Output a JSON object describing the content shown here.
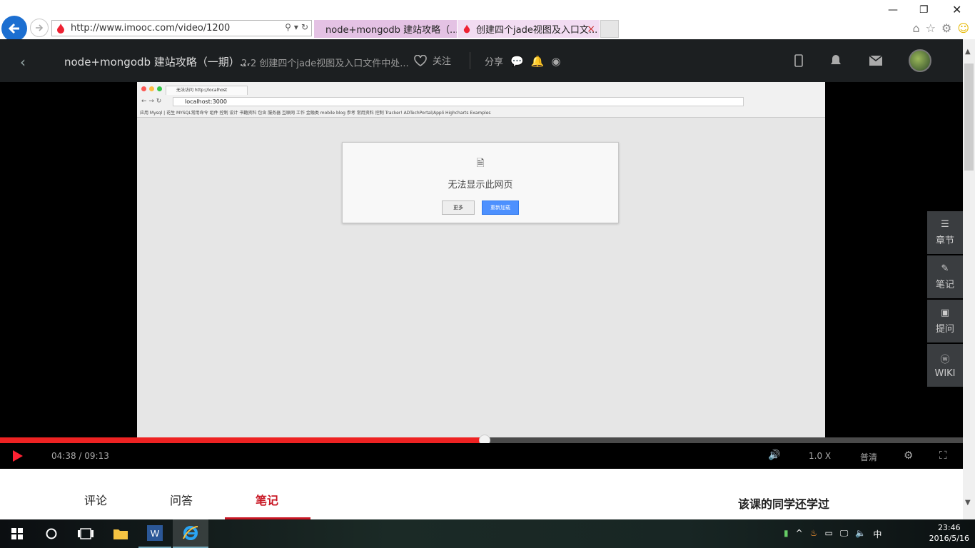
{
  "browser": {
    "url": "http://www.imooc.com/video/1200",
    "tabs": [
      {
        "label": "node+mongodb 建站攻略（..."
      },
      {
        "label": "创建四个jade视图及入口文...",
        "close": "×"
      }
    ]
  },
  "header": {
    "back": "‹",
    "course_title": "node+mongodb 建站攻略（一期）...",
    "lesson_title": "2-2 创建四个jade视图及入口文件中处...",
    "follow_label": "关注",
    "share_label": "分享"
  },
  "video_frame": {
    "chrome_tab": "无法访问 http://localhost",
    "address": "localhost:3000",
    "bookmarks": "应用   Mysql | 花生   MYSQL常用命令   组件   控制   设计   书籍资料   包含   服务器   互联网   工作   金融类   mobile   blog   参考   常用资料   控制   Tracker!   ADTechPortal/Appli   Highcharts Examples",
    "error_title": "无法显示此网页",
    "more_button": "更多",
    "reload_button": "重新加载"
  },
  "side_tabs": [
    {
      "label": "章节",
      "icon": "list-icon"
    },
    {
      "label": "笔记",
      "icon": "pencil-icon"
    },
    {
      "label": "提问",
      "icon": "question-icon"
    },
    {
      "label": "WIKI",
      "icon": "wiki-icon"
    }
  ],
  "player": {
    "time": "04:38 / 09:13",
    "progress": 0.503,
    "speed": "1.0 X",
    "quality": "普清"
  },
  "below_tabs": {
    "comments": "评论",
    "qa": "问答",
    "notes": "笔记",
    "also_learned": "该课的同学还学过"
  },
  "taskbar": {
    "time": "23:46",
    "date": "2016/5/16",
    "ime": "中"
  },
  "colors": {
    "accent_red": "#c81623",
    "header_bg": "#1c1f21",
    "ie_blue": "#1c6fd1"
  }
}
